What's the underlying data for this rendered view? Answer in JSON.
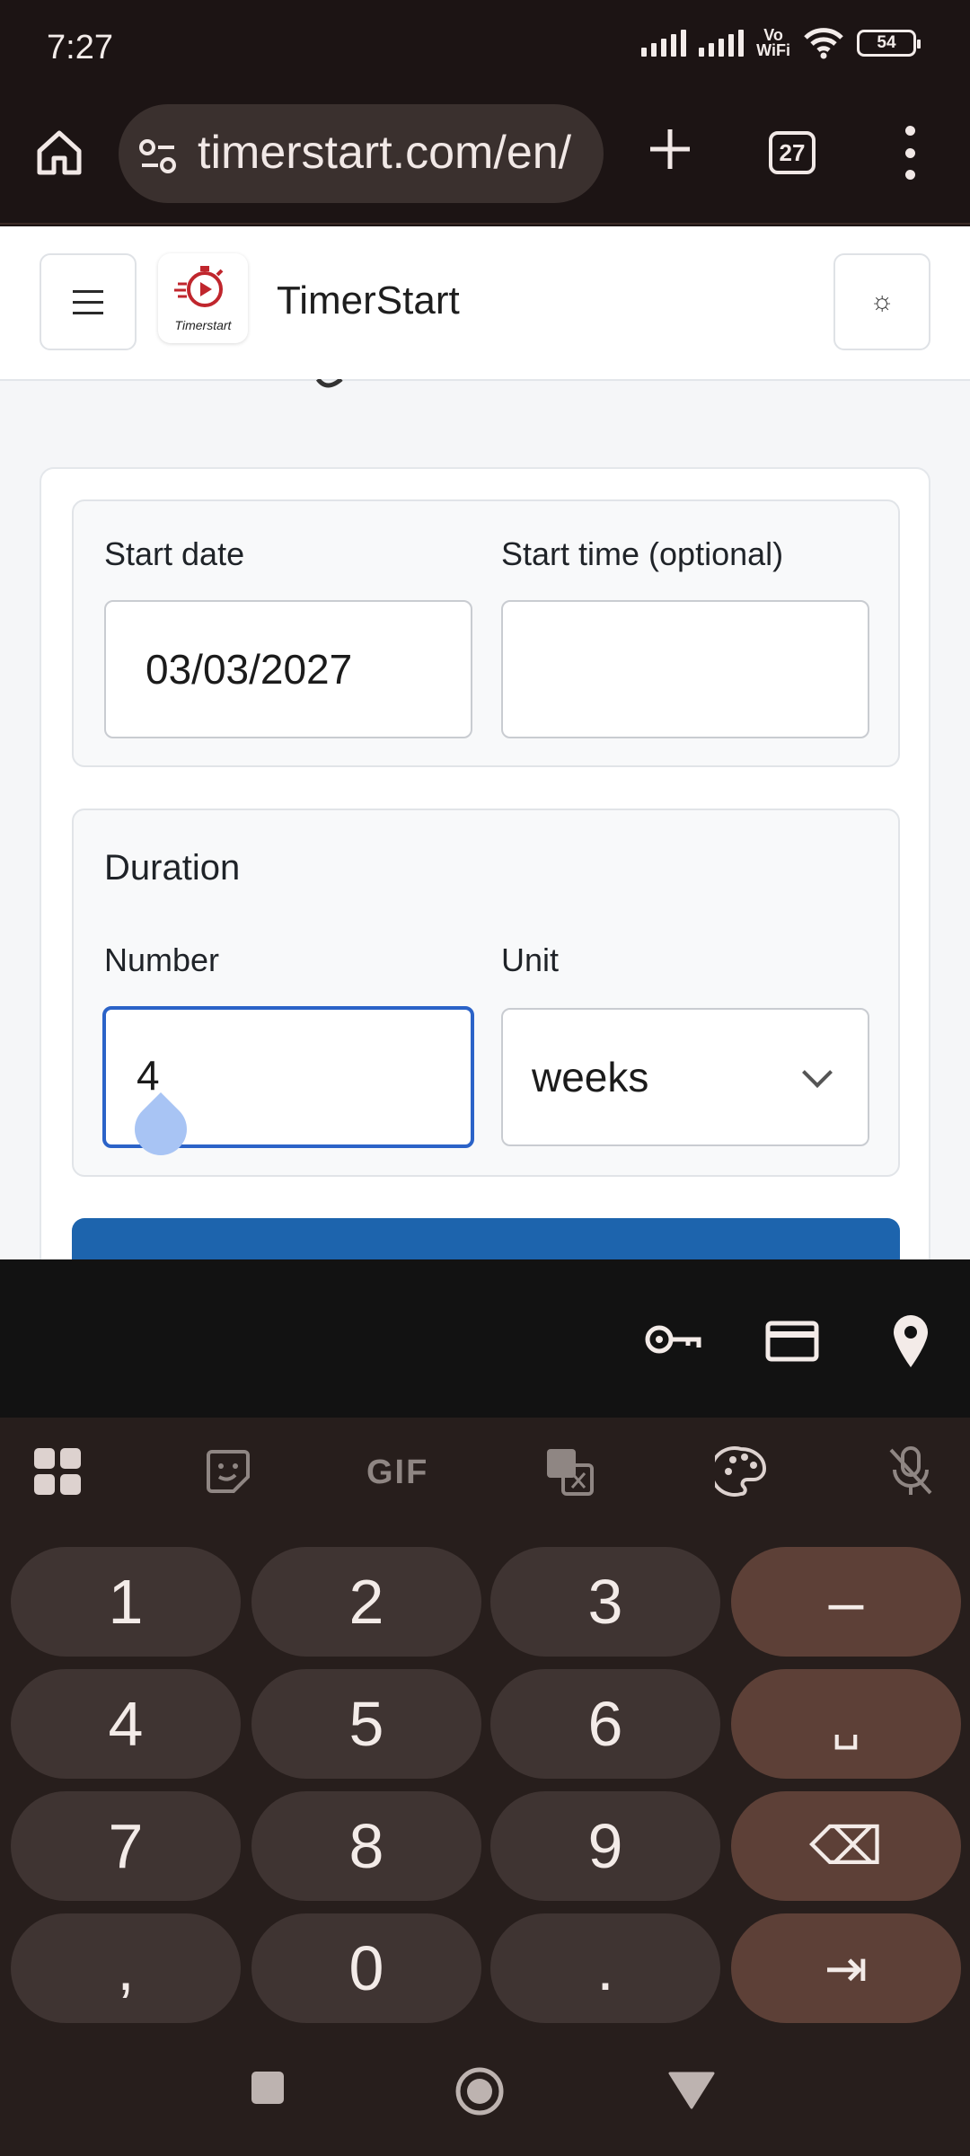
{
  "status_bar": {
    "time": "7:27",
    "network_label": "Vo\nWiFi",
    "battery": "54"
  },
  "browser": {
    "url": "timerstart.com/en/",
    "tab_count": "27"
  },
  "header": {
    "brand": "TimerStart",
    "logo_text": "Timerstart",
    "theme_icon": "☼"
  },
  "form": {
    "start_date_label": "Start date",
    "start_date_value": "03/03/2027",
    "start_time_label": "Start time (optional)",
    "start_time_value": "",
    "duration_title": "Duration",
    "number_label": "Number",
    "number_value": "4",
    "unit_label": "Unit",
    "unit_value": "weeks"
  },
  "keyboard": {
    "rows": [
      [
        "1",
        "2",
        "3",
        "–"
      ],
      [
        "4",
        "5",
        "6",
        "␣"
      ],
      [
        "7",
        "8",
        "9",
        "⌫"
      ],
      [
        ",",
        "0",
        ".",
        "⇥"
      ]
    ],
    "gif_label": "GIF"
  },
  "colors": {
    "accent": "#2b63c8",
    "submit": "#1d64ad",
    "keyboard_fn": "#5d4037",
    "keyboard_key": "#3f3432"
  }
}
